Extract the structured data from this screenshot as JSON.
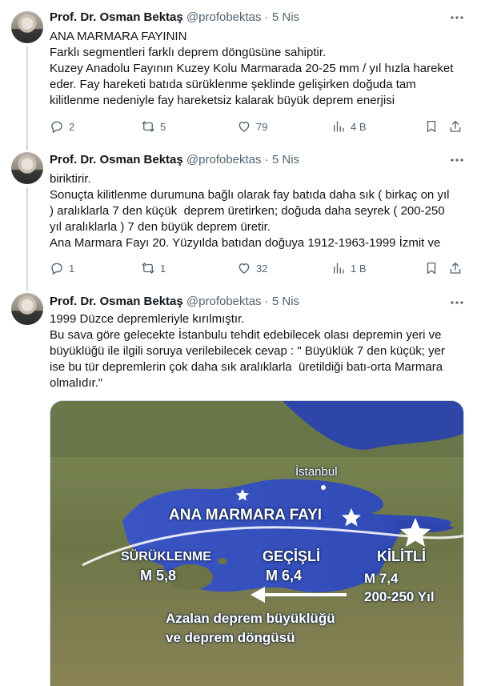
{
  "tweets": [
    {
      "name": "Prof. Dr. Osman Bektaş",
      "handle": "@profobektas",
      "sep": "·",
      "date": "5 Nis",
      "lines": [
        "ANA MARMARA FAYININ",
        "Farklı segmentleri farklı deprem döngüsüne sahiptir.",
        "Kuzey Anadolu Fayının Kuzey Kolu Marmarada 20-25 mm / yıl hızla hareket",
        "eder. Fay hareketi batıda sürüklenme şeklinde gelişirken doğuda tam",
        "kilitlenme nedeniyle fay hareketsiz kalarak büyük deprem enerjisi"
      ],
      "replies": "2",
      "retweets": "5",
      "likes": "79",
      "views": "4 B"
    },
    {
      "name": "Prof. Dr. Osman Bektaş",
      "handle": "@profobektas",
      "sep": "·",
      "date": "5 Nis",
      "lines": [
        "biriktirir.",
        "Sonuçta kilitlenme durumuna bağlı olarak fay batıda daha sık ( birkaç on yıl",
        ") aralıklarla 7 den küçük  deprem üretirken; doğuda daha seyrek ( 200-250",
        "yıl aralıklarla ) 7 den büyük deprem üretir.",
        "Ana Marmara Fayı 20. Yüzyılda batıdan doğuya 1912-1963-1999 İzmit ve"
      ],
      "replies": "1",
      "retweets": "1",
      "likes": "32",
      "views": "1 B"
    },
    {
      "name": "Prof. Dr. Osman Bektaş",
      "handle": "@profobektas",
      "sep": "·",
      "date": "5 Nis",
      "lines": [
        "1999 Düzce depremleriyle kırılmıştır.",
        "Bu sava göre gelecekte İstanbulu tehdit edebilecek olası depremin yeri ve",
        "büyüklüğü ile ilgili soruya verilebilecek cevap : \" Büyüklük 7 den küçük; yer",
        "ise bu tür depremlerin çok daha sık aralıklarla  üretildiği batı-orta Marmara",
        "olmalıdır.\""
      ]
    }
  ],
  "map": {
    "city": "İstanbul",
    "fault_title": "ANA MARMARA FAYI",
    "west_label": "SÜRÜKLENME",
    "west_mag": "M 5,8",
    "mid_label": "GEÇİŞLİ",
    "mid_mag": "M 6,4",
    "east_label": "KİLİTLİ",
    "east_mag": "M 7,4",
    "east_cycle": "200-250 Yıl",
    "arrow_text_1": "Azalan deprem büyüklüğü",
    "arrow_text_2": "ve deprem döngüsü"
  },
  "colors": {
    "text": "#0f1419",
    "muted": "#536471",
    "sea": "#3d57c9",
    "land": "#6f7a4a"
  },
  "icons": [
    "more-icon",
    "reply-icon",
    "retweet-icon",
    "like-icon",
    "views-icon",
    "bookmark-icon",
    "share-icon"
  ]
}
